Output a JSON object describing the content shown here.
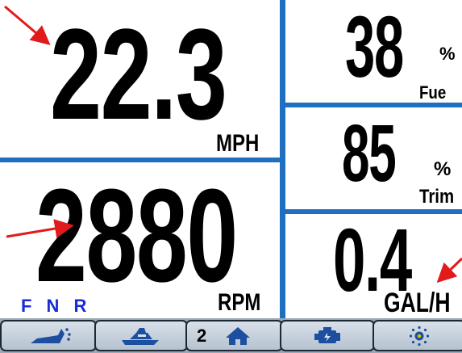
{
  "speed": {
    "value": "22.3",
    "unit": "MPH"
  },
  "rpm": {
    "value": "2880",
    "unit": "RPM",
    "gear_indicator": "F N R"
  },
  "fuel": {
    "value": "38",
    "percent": "%",
    "label": "Fue"
  },
  "trim": {
    "value": "85",
    "percent": "%",
    "label": "Trim"
  },
  "fuel_flow": {
    "value": "0.4",
    "unit": "GAL/H"
  },
  "toolbar": {
    "buttons": [
      {
        "icon": "foot-pedal-icon"
      },
      {
        "icon": "boat-icon"
      },
      {
        "label": "2",
        "icon": "home-icon"
      },
      {
        "icon": "engine-icon"
      },
      {
        "icon": "brightness-icon"
      }
    ]
  },
  "colors": {
    "divider": "#1f6fc1",
    "gear_text": "#1a2bd8",
    "annotation": "#e11b1b",
    "toolbar_bg": "#9aa8b8"
  }
}
